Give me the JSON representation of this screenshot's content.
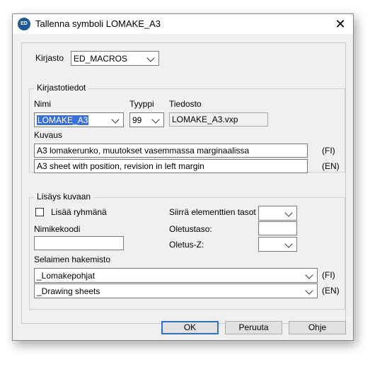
{
  "window": {
    "title": "Tallenna symboli LOMAKE_A3",
    "icon_text": "ED",
    "close_glyph": "✕"
  },
  "library": {
    "label": "Kirjasto",
    "value": "ED_MACROS"
  },
  "library_info": {
    "legend": "Kirjastotiedot",
    "name_label": "Nimi",
    "name_value": "LOMAKE_A3",
    "type_label": "Tyyppi",
    "type_value": "99",
    "file_label": "Tiedosto",
    "file_value": "LOMAKE_A3.vxp",
    "description_label": "Kuvaus",
    "desc_fi": "A3 lomakerunko, muutokset vasemmassa marginaalissa",
    "desc_fi_lang": "(FI)",
    "desc_en": "A3 sheet with position, revision in left margin",
    "desc_en_lang": "(EN)"
  },
  "add_image": {
    "legend": "Lisäys kuvaan",
    "add_to_group_label": "Lisää ryhmänä",
    "add_to_group_checked": false,
    "item_code_label": "Nimikekoodi",
    "item_code_value": "",
    "move_layers_label": "Siirrä elementtien tasot",
    "move_layers_value": "",
    "default_layer_label": "Oletustaso:",
    "default_layer_value": "",
    "default_z_label": "Oletus-Z:",
    "default_z_value": "",
    "browser_dir_label": "Selaimen hakemisto",
    "dir_fi": "_Lomakepohjat",
    "dir_fi_lang": "(FI)",
    "dir_en": "_Drawing sheets",
    "dir_en_lang": "(EN)"
  },
  "buttons": {
    "ok": "OK",
    "cancel": "Peruuta",
    "help": "Ohje"
  }
}
